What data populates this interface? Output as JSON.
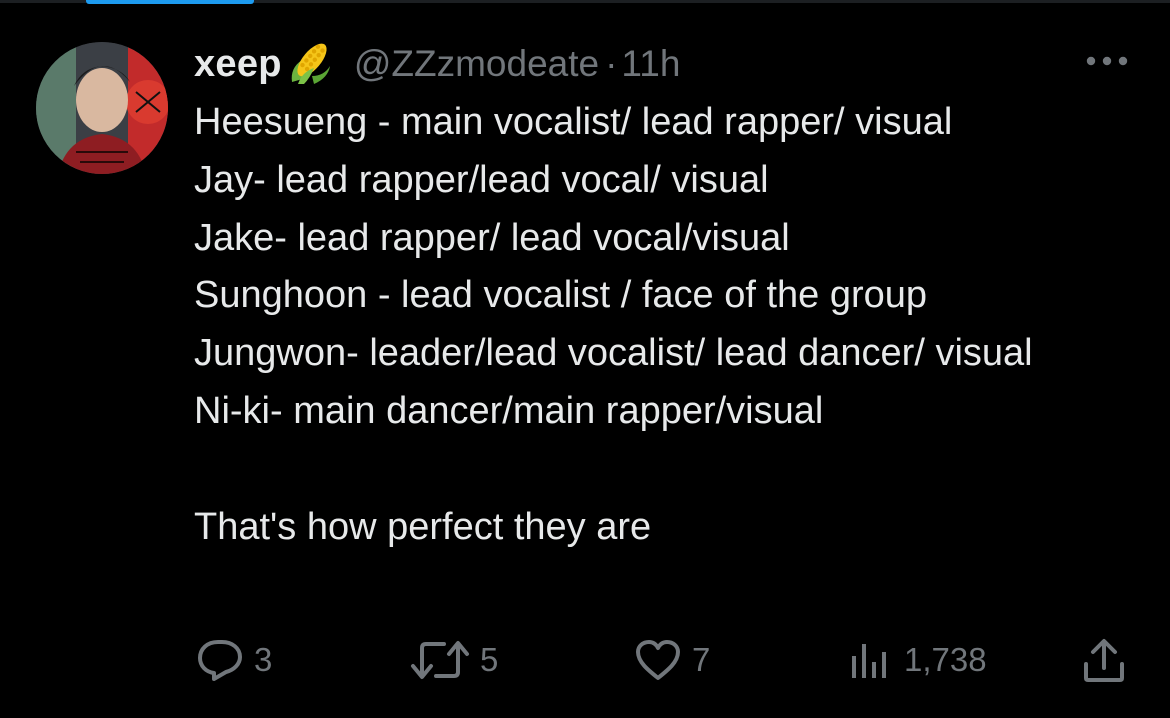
{
  "tweet": {
    "display_name": "xeep",
    "badge_emoji": "corn-emoji",
    "handle": "@ZZzmodeate",
    "separator": "·",
    "time": "11h",
    "lines": [
      "Heesueng - main vocalist/ lead rapper/ visual",
      "Jay- lead rapper/lead vocal/ visual",
      "Jake- lead rapper/ lead vocal/visual",
      "Sunghoon - lead vocalist / face of the group",
      "Jungwon- leader/lead vocalist/ lead dancer/ visual",
      "Ni-ki- main dancer/main rapper/visual",
      "That's how perfect they are"
    ]
  },
  "actions": {
    "reply": {
      "icon": "reply-icon",
      "count": "3"
    },
    "retweet": {
      "icon": "retweet-icon",
      "count": "5"
    },
    "like": {
      "icon": "heart-icon",
      "count": "7"
    },
    "views": {
      "icon": "views-icon",
      "count": "1,738"
    },
    "share": {
      "icon": "share-icon"
    }
  },
  "colors": {
    "background": "#000000",
    "text": "#e7e9ea",
    "secondary": "#71767b",
    "accent": "#1d9bf0"
  }
}
